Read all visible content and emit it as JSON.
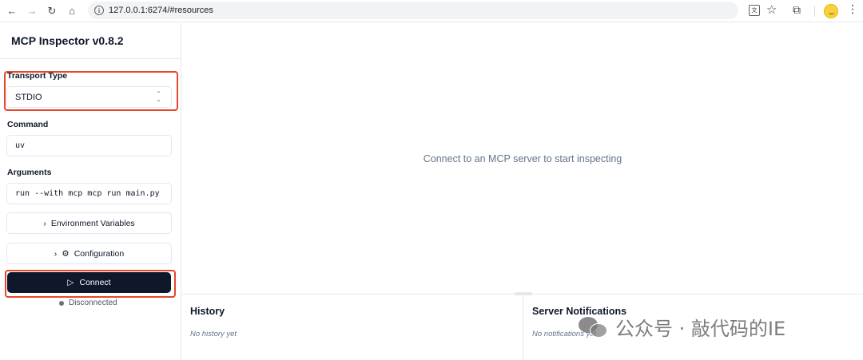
{
  "browser": {
    "url": "127.0.0.1:6274/#resources",
    "icons": [
      "back-icon",
      "forward-icon",
      "reload-icon",
      "home-icon",
      "site-info-icon",
      "translate-icon",
      "bookmark-star-icon",
      "extensions-icon",
      "profile-avatar",
      "menu-kebab-icon"
    ]
  },
  "sidebar": {
    "title": "MCP Inspector v0.8.2",
    "transport": {
      "label": "Transport Type",
      "value": "STDIO"
    },
    "command": {
      "label": "Command",
      "value": "uv"
    },
    "arguments": {
      "label": "Arguments",
      "value": "run --with mcp mcp run main.py"
    },
    "env_button": "Environment Variables",
    "config_button": "Configuration",
    "connect_button": "Connect",
    "status": "Disconnected"
  },
  "main": {
    "empty_message": "Connect to an MCP server to start inspecting"
  },
  "history": {
    "title": "History",
    "empty": "No history yet"
  },
  "notifications": {
    "title": "Server Notifications",
    "empty": "No notifications yet"
  },
  "watermark": {
    "text": "公众号 · 敲代码的IE"
  },
  "colors": {
    "highlight": "#e3472e",
    "primary": "#0f172a",
    "muted": "#64748b"
  }
}
